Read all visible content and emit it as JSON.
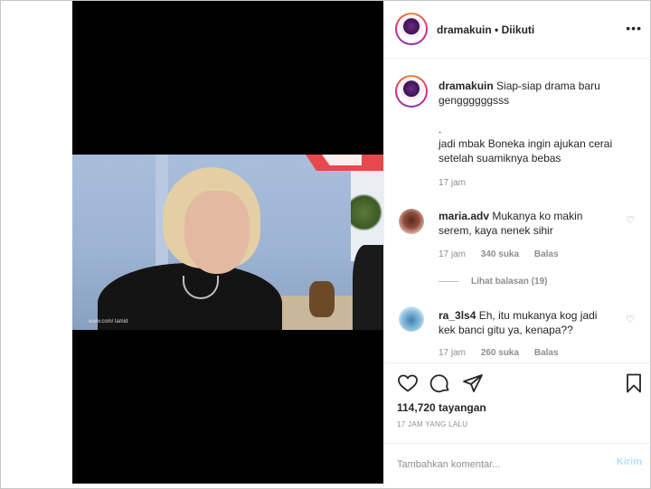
{
  "header": {
    "username": "dramakuin",
    "separator": "•",
    "follow_status": "Diikuti",
    "more_icon": "more-horizontal-icon"
  },
  "media": {
    "watermark": "www.com/ lamid"
  },
  "caption": {
    "username": "dramakuin",
    "line1": "Siap-siap drama baru",
    "line2": "genggggggsss",
    "line3": ".",
    "line4": "jadi mbak Boneka ingin ajukan cerai",
    "line5": "setelah suamiknya bebas",
    "time": "17 jam"
  },
  "comments": [
    {
      "username": "maria.adv",
      "line1": "Mukanya ko makin",
      "line2": "serem, kaya nenek sihir",
      "time": "17 jam",
      "likes": "340 suka",
      "reply": "Balas",
      "view_replies": "Lihat balasan (19)"
    },
    {
      "username": "ra_3ls4",
      "line1": "Eh, itu mukanya kog jadi",
      "line2": "kek banci gitu ya, kenapa??",
      "time": "17 jam",
      "likes": "260 suka",
      "reply": "Balas"
    }
  ],
  "actions": {
    "views": "114,720 tayangan",
    "posted_ago": "17 JAM YANG LALU"
  },
  "add_comment": {
    "placeholder": "Tambahkan komentar...",
    "post_label": "Kirim"
  }
}
